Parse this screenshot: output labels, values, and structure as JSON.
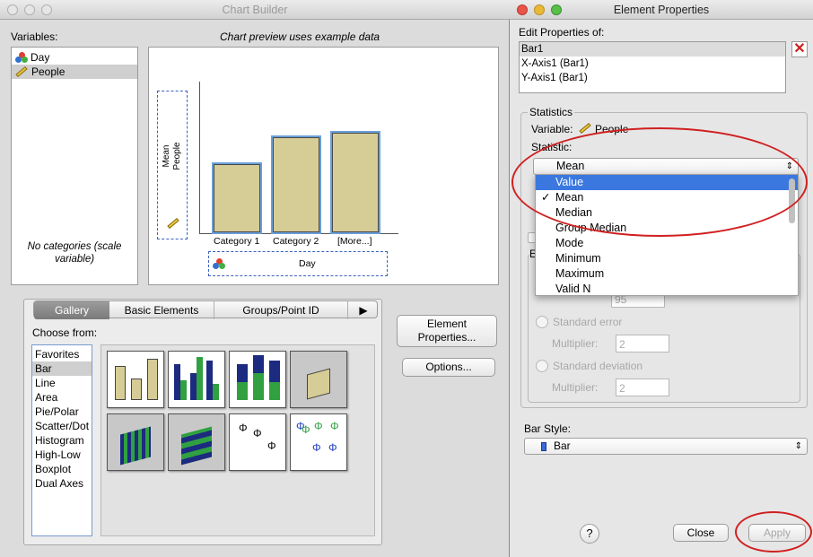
{
  "chart_builder": {
    "title": "Chart Builder",
    "variables_label": "Variables:",
    "preview_note": "Chart preview uses example data",
    "variables": [
      {
        "name": "Day",
        "icon": "nominal-icon"
      },
      {
        "name": "People",
        "icon": "scale-ruler-icon"
      }
    ],
    "no_categories": "No categories (scale variable)",
    "y_drop_zone": {
      "line1": "Mean",
      "line2": "People"
    },
    "x_drop_zone": "Day",
    "preview_categories": [
      "Category 1",
      "Category 2",
      "[More...]"
    ],
    "preview_values": [
      0.62,
      0.87,
      0.91
    ],
    "tabs": [
      "Gallery",
      "Basic Elements",
      "Groups/Point ID"
    ],
    "choose_from": "Choose from:",
    "chart_types": [
      "Favorites",
      "Bar",
      "Line",
      "Area",
      "Pie/Polar",
      "Scatter/Dot",
      "Histogram",
      "High-Low",
      "Boxplot",
      "Dual Axes"
    ],
    "selected_chart_type": "Bar",
    "element_properties_button": {
      "line1": "Element",
      "line2": "Properties..."
    },
    "options_button": "Options..."
  },
  "element_properties": {
    "title": "Element Properties",
    "edit_label": "Edit Properties of:",
    "edit_items": [
      "Bar1",
      "X-Axis1 (Bar1)",
      "Y-Axis1 (Bar1)"
    ],
    "statistics_group": "Statistics",
    "variable_label": "Variable:",
    "variable_value": "People",
    "statistic_label": "Statistic:",
    "statistic_selected": "Mean",
    "statistic_options": [
      "Value",
      "Mean",
      "Median",
      "Group Median",
      "Mode",
      "Minimum",
      "Maximum",
      "Valid N"
    ],
    "highlighted_option": "Value",
    "checked_option": "Mean",
    "error_bars_partial": "E",
    "confidence_value": "95",
    "standard_error": "Standard error",
    "standard_deviation": "Standard deviation",
    "multiplier_label": "Multiplier:",
    "multiplier_se": "2",
    "multiplier_sd": "2",
    "bar_style_label": "Bar Style:",
    "bar_style_value": "Bar",
    "help_glyph": "?",
    "close_button": "Close",
    "apply_button": "Apply"
  },
  "colors": {
    "bar_fill": "#d6cc96",
    "selection": "#4a80d8",
    "annotation_red": "#d02020"
  }
}
